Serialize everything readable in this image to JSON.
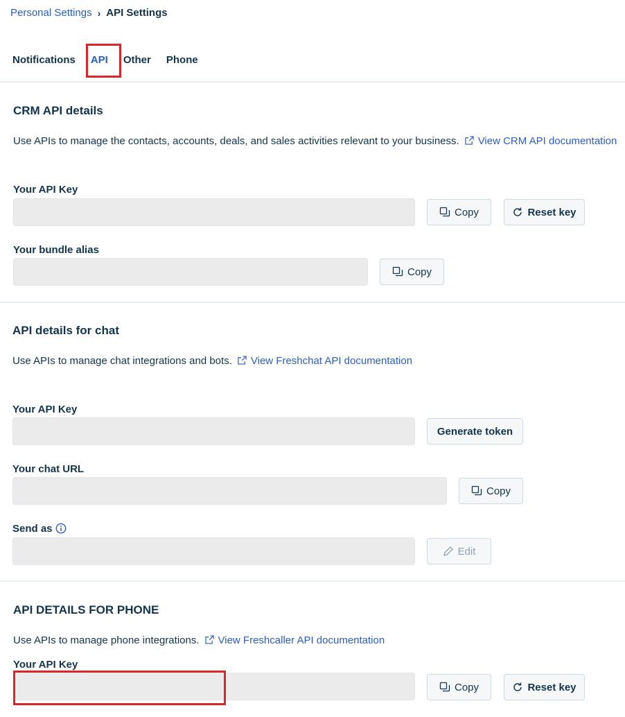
{
  "breadcrumb": {
    "parent": "Personal Settings",
    "separator": "›",
    "current": "API Settings"
  },
  "tabs": [
    {
      "label": "Notifications",
      "active": false
    },
    {
      "label": "API",
      "active": true
    },
    {
      "label": "Other",
      "active": false
    },
    {
      "label": "Phone",
      "active": false
    }
  ],
  "crm": {
    "title": "CRM API details",
    "description": "Use APIs to manage the contacts, accounts, deals, and sales activities relevant to your business.",
    "doc_link": "View CRM API documentation",
    "api_key_label": "Your API Key",
    "copy_label": "Copy",
    "reset_label": "Reset key",
    "bundle_alias_label": "Your bundle alias",
    "bundle_copy_label": "Copy"
  },
  "chat": {
    "title": "API details for chat",
    "description": "Use APIs to manage chat integrations and bots.",
    "doc_link": "View Freshchat API documentation",
    "api_key_label": "Your API Key",
    "generate_label": "Generate token",
    "chat_url_label": "Your chat URL",
    "chat_url_copy_label": "Copy",
    "send_as_label": "Send as",
    "edit_label": "Edit"
  },
  "phone": {
    "title": "API DETAILS FOR PHONE",
    "description": "Use APIs to manage phone integrations.",
    "doc_link": "View Freshcaller API documentation",
    "api_key_label": "Your API Key",
    "copy_label": "Copy",
    "reset_label": "Reset key"
  },
  "colors": {
    "accent": "#2c5cc5",
    "highlight": "#d9262b",
    "text": "#12344d",
    "field_bg": "#ebebeb"
  },
  "icons": {
    "external_link": "external-link-icon",
    "copy": "copy-icon",
    "reset": "refresh-icon",
    "edit": "pencil-icon",
    "info": "info-icon",
    "separator": "chevron-right-icon"
  }
}
